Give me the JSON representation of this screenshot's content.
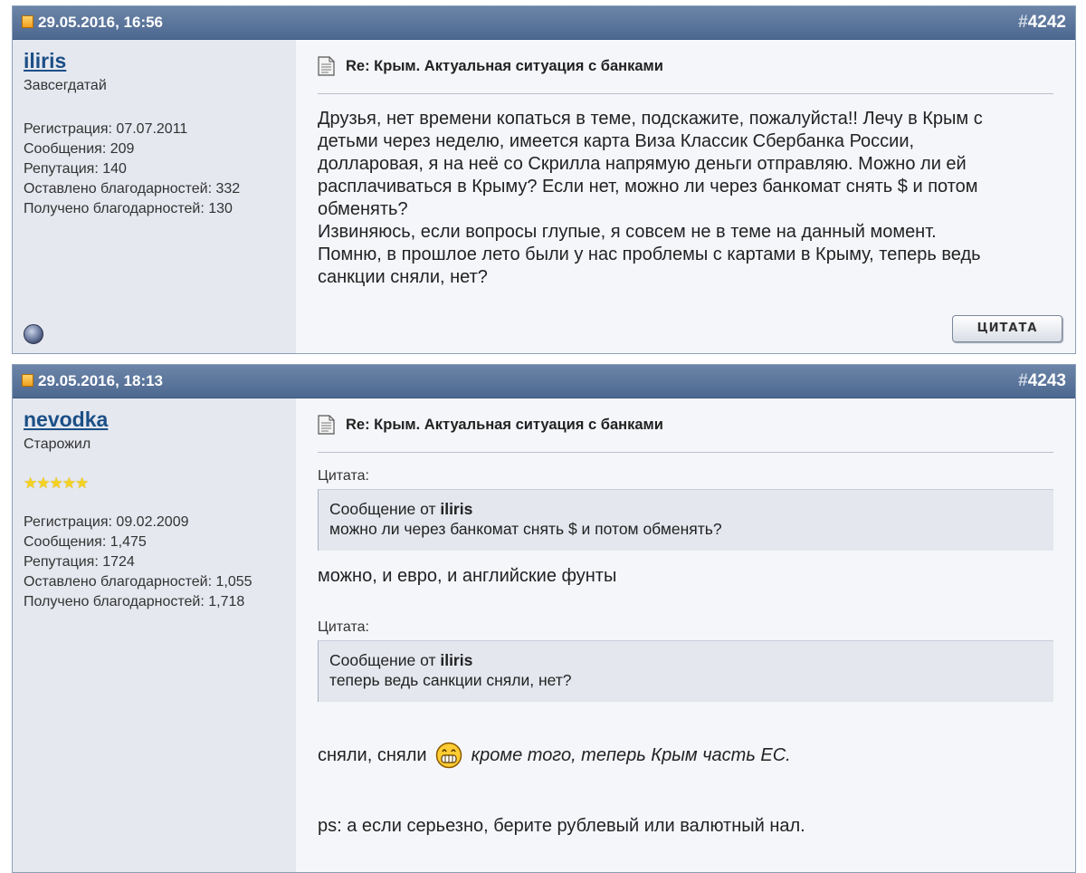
{
  "posts": [
    {
      "date": "29.05.2016, 16:56",
      "number_prefix": "#",
      "number": "4242",
      "username": "iliris",
      "user_title": "Завсегдатай",
      "stats": [
        "Регистрация: 07.07.2011",
        "Сообщения: 209",
        "Репутация: 140",
        "Оставлено благодарностей: 332",
        "Получено благодарностей: 130"
      ],
      "title": "Re: Крым. Актуальная ситуация с банками",
      "body_lines": [
        "Друзья, нет времени копаться в теме, подскажите, пожалуйста!! Лечу в Крым с",
        "детьми через неделю, имеется карта Виза Классик Сбербанка России,",
        "долларовая, я на неё со Скрилла напрямую деньги отправляю. Можно ли ей",
        "расплачиваться в Крыму? Если нет, можно ли через банкомат снять $ и потом",
        "обменять?",
        "Извиняюсь, если вопросы глупые, я совсем не в теме на данный момент.",
        "Помню, в прошлое лето были у нас проблемы с картами в Крыму, теперь ведь",
        "санкции сняли, нет?"
      ],
      "quote_button": "ЦИТАТА"
    },
    {
      "date": "29.05.2016, 18:13",
      "number_prefix": "#",
      "number": "4243",
      "username": "nevodka",
      "user_title": "Старожил",
      "stars": "★★★★★",
      "stats": [
        "Регистрация: 09.02.2009",
        "Сообщения: 1,475",
        "Репутация: 1724",
        "Оставлено благодарностей: 1,055",
        "Получено благодарностей: 1,718"
      ],
      "title": "Re: Крым. Актуальная ситуация с банками",
      "quote_label": "Цитата:",
      "quotes": [
        {
          "from_prefix": "Сообщение от",
          "author": "iliris",
          "text": "можно ли через банкомат снять $ и потом обменять?"
        },
        {
          "from_prefix": "Сообщение от",
          "author": "iliris",
          "text": "теперь ведь санкции сняли, нет?"
        }
      ],
      "reply1": "можно, и евро, и английские фунты",
      "reply2_plain": "сняли, сняли",
      "reply2_italic": "кроме того, теперь Крым часть ЕС.",
      "reply3": "ps: а если серьезно, берите рублевый или валютный нал."
    }
  ],
  "colors": {
    "header": "#556f96",
    "user_column": "#e5e8ef",
    "content": "#f5f6fa",
    "username": "#1b4f86",
    "quote_box": "#e4e7ee"
  },
  "icons": [
    "post-status-icon",
    "post-page-icon",
    "online-status-icon",
    "grin-smiley-icon"
  ]
}
